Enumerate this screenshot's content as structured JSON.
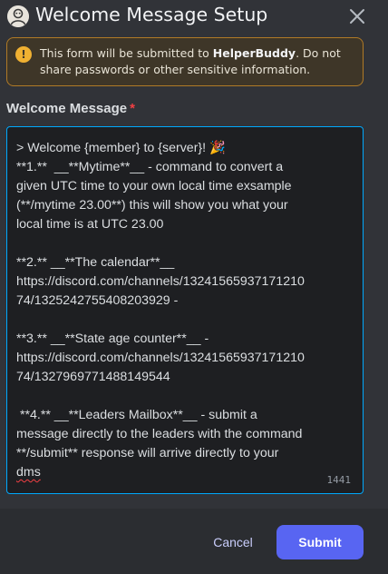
{
  "modal": {
    "title": "Welcome Message Setup",
    "app_icon": "bot-avatar-icon",
    "close_icon": "close-icon"
  },
  "notice": {
    "icon": "warning-icon",
    "icon_glyph": "!",
    "text_before": "This form will be submitted to ",
    "app_name": "HelperBuddy",
    "text_after": ". Do not share passwords or other sensitive information."
  },
  "form": {
    "label": "Welcome Message",
    "required_mark": "*",
    "message_lines": [
      "> Welcome {member} to {server}! 🎉",
      "**1.**  __**Mytime**__ - command to convert a",
      "given UTC time to your own local time exsample",
      "(**/mytime 23.00**) this will show you what your",
      "local time is at UTC 23.00",
      "",
      "**2.** __**The calendar**__",
      "https://discord.com/channels/13241565937171210",
      "74/1325242755408203929 -",
      "",
      "**3.** __**State age counter**__ -",
      "https://discord.com/channels/13241565937171210",
      "74/1327969771488149544",
      "",
      " **4.** __**Leaders Mailbox**__ - submit a",
      "message directly to the leaders with the command",
      "**/submit** response will arrive directly to your"
    ],
    "last_line": "dms",
    "char_count": "1441"
  },
  "footer": {
    "cancel_label": "Cancel",
    "submit_label": "Submit"
  },
  "colors": {
    "accent": "#5865f2",
    "warning": "#f0b132",
    "focus_border": "#00a8fc",
    "required": "#f23f43"
  }
}
